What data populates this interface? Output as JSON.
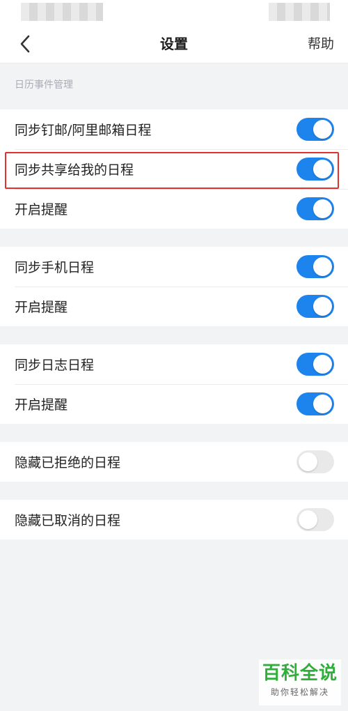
{
  "nav": {
    "title": "设置",
    "help_label": "帮助"
  },
  "section_header": "日历事件管理",
  "groups": [
    {
      "rows": [
        {
          "label": "同步钉邮/阿里邮箱日程",
          "on": true
        },
        {
          "label": "同步共享给我的日程",
          "on": true
        },
        {
          "label": "开启提醒",
          "on": true
        }
      ]
    },
    {
      "rows": [
        {
          "label": "同步手机日程",
          "on": true
        },
        {
          "label": "开启提醒",
          "on": true
        }
      ]
    },
    {
      "rows": [
        {
          "label": "同步日志日程",
          "on": true
        },
        {
          "label": "开启提醒",
          "on": true
        }
      ]
    },
    {
      "rows": [
        {
          "label": "隐藏已拒绝的日程",
          "on": false
        }
      ]
    },
    {
      "rows": [
        {
          "label": "隐藏已取消的日程",
          "on": false
        }
      ]
    }
  ],
  "watermark": {
    "main": "百科全说",
    "sub": "助你轻松解决"
  },
  "colors": {
    "toggle_on": "#1d84ee",
    "toggle_off": "#e9e9ea",
    "highlight": "#e2302c",
    "watermark_green": "#2fae3a"
  },
  "icons": {
    "back": "chevron-left-icon"
  }
}
